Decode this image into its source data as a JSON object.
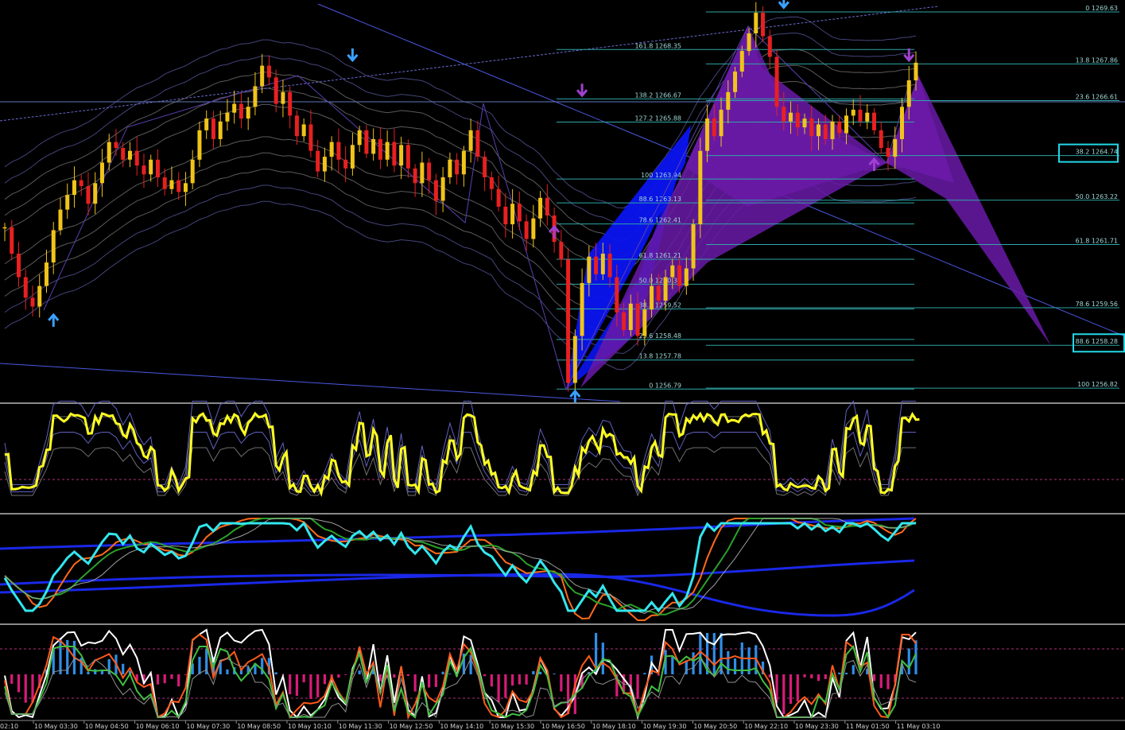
{
  "chart_data": {
    "type": "candlestick",
    "price_panel": {
      "fib_left": [
        {
          "label": "161.8 1268.35",
          "price": 1268.35
        },
        {
          "label": "138.2 1266.67",
          "price": 1266.67
        },
        {
          "label": "127.2 1265.88",
          "price": 1265.88
        },
        {
          "label": "100 1263.94",
          "price": 1263.94
        },
        {
          "label": "88.6 1263.13",
          "price": 1263.13
        },
        {
          "label": "78.6 1262.41",
          "price": 1262.41
        },
        {
          "label": "61.8 1261.21",
          "price": 1261.21
        },
        {
          "label": "50.0 1260.36",
          "price": 1260.36
        },
        {
          "label": "38.2 1259.52",
          "price": 1259.52
        },
        {
          "label": "23.6 1258.48",
          "price": 1258.48
        },
        {
          "label": "13.8 1257.78",
          "price": 1257.78
        },
        {
          "label": "0 1256.79",
          "price": 1256.79
        }
      ],
      "fib_right": [
        {
          "label": "0 1269.63",
          "price": 1269.63
        },
        {
          "label": "13.8 1267.86",
          "price": 1267.86
        },
        {
          "label": "23.6 1266.61",
          "price": 1266.61
        },
        {
          "label": "38.2 1264.74",
          "price": 1264.74,
          "boxed": true
        },
        {
          "label": "50.0 1263.22",
          "price": 1263.22
        },
        {
          "label": "61.8 1261.71",
          "price": 1261.71
        },
        {
          "label": "78.6 1259.56",
          "price": 1259.56
        },
        {
          "label": "88.6 1258.28",
          "price": 1258.28,
          "boxed": true
        },
        {
          "label": "100 1256.82",
          "price": 1256.82
        }
      ],
      "candle_closes": [
        1262.3,
        1261.4,
        1260.6,
        1259.9,
        1259.6,
        1260.3,
        1261.1,
        1262.2,
        1262.9,
        1263.4,
        1263.9,
        1263.7,
        1263.1,
        1263.8,
        1264.5,
        1265.2,
        1265.0,
        1264.6,
        1264.9,
        1264.4,
        1264.1,
        1264.6,
        1264.0,
        1263.6,
        1263.9,
        1263.5,
        1263.8,
        1264.6,
        1265.6,
        1266.0,
        1265.3,
        1265.9,
        1266.2,
        1266.5,
        1266.0,
        1266.4,
        1267.1,
        1267.8,
        1267.4,
        1266.5,
        1266.9,
        1266.1,
        1265.4,
        1265.8,
        1264.9,
        1264.2,
        1264.7,
        1265.2,
        1264.6,
        1264.3,
        1265.1,
        1265.6,
        1264.8,
        1265.3,
        1264.6,
        1265.2,
        1264.4,
        1265.1,
        1264.3,
        1263.8,
        1264.5,
        1263.9,
        1263.2,
        1264.0,
        1264.6,
        1264.1,
        1264.9,
        1265.6,
        1264.7,
        1264.0,
        1263.6,
        1263.0,
        1262.4,
        1263.1,
        1262.5,
        1261.9,
        1262.6,
        1263.3,
        1262.7,
        1261.8,
        1261.2,
        1257.0,
        1258.6,
        1260.4,
        1261.3,
        1260.7,
        1261.4,
        1260.6,
        1259.4,
        1258.8,
        1259.7,
        1258.6,
        1259.5,
        1260.3,
        1259.8,
        1260.6,
        1261.0,
        1260.3,
        1260.9,
        1262.4,
        1264.9,
        1266.0,
        1265.4,
        1266.3,
        1266.9,
        1267.6,
        1268.3,
        1268.9,
        1269.6,
        1268.8,
        1268.1,
        1266.4,
        1265.9,
        1266.2,
        1265.7,
        1266.0,
        1265.4,
        1265.8,
        1265.3,
        1265.9,
        1265.5,
        1266.1,
        1266.3,
        1265.9,
        1266.2,
        1265.6,
        1265.0,
        1264.7,
        1265.3,
        1266.4,
        1267.3,
        1267.9
      ],
      "arrows": [
        {
          "index": 7,
          "dir": "up",
          "color": "#3aa0ff",
          "price": 1259.4
        },
        {
          "index": 50,
          "dir": "down",
          "color": "#3aa0ff",
          "price": 1267.9
        },
        {
          "index": 82,
          "dir": "up",
          "color": "#3aa0ff",
          "price": 1256.8
        },
        {
          "index": 112,
          "dir": "down",
          "color": "#3aa0ff",
          "price": 1269.7
        },
        {
          "index": 83,
          "dir": "down",
          "color": "#a040d0",
          "price": 1266.7
        },
        {
          "index": 79,
          "dir": "up",
          "color": "#a040d0",
          "price": 1262.4
        },
        {
          "index": 130,
          "dir": "down",
          "color": "#a040d0",
          "price": 1267.9
        },
        {
          "index": 125,
          "dir": "up",
          "color": "#a040d0",
          "price": 1264.7
        }
      ]
    },
    "x_tick_labels": [
      "10 May 03:30",
      "10 May 04:50",
      "10 May 06:10",
      "10 May 07:30",
      "10 May 08:50",
      "10 May 10:10",
      "10 May 11:30",
      "10 May 12:50",
      "10 May 14:10",
      "10 May 15:30",
      "10 May 16:50",
      "10 May 18:10",
      "10 May 19:30",
      "10 May 20:50",
      "10 May 22:10",
      "10 May 23:30",
      "11 May 01:50",
      "11 May 03:10"
    ],
    "x_tick_first": "02:10",
    "colors": {
      "bull": "#f0c419",
      "bear": "#e82020",
      "fib": "#2fa6a6",
      "pattern_blue": "#0a14f0",
      "pattern_purple": "#6a1aa8",
      "osc_yellow": "#ffff22",
      "osc_cyan": "#33e6ee",
      "hist_pos": "#2f8ee8",
      "hist_neg": "#d81b78"
    }
  }
}
